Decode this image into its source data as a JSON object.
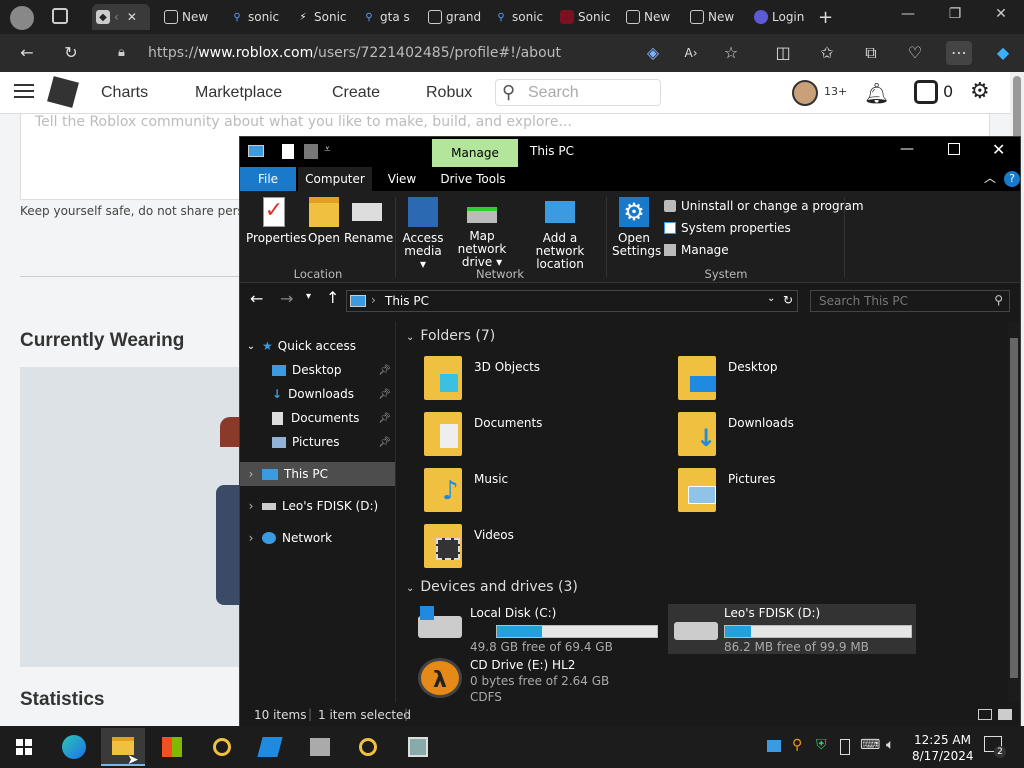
{
  "browser": {
    "tabs": [
      {
        "label": "",
        "icon": "roblox-icon"
      },
      {
        "label": "New",
        "icon": "newtab-icon"
      },
      {
        "label": "sonic",
        "icon": "search-icon"
      },
      {
        "label": "Sonic",
        "icon": "sonic-icon"
      },
      {
        "label": "gta s",
        "icon": "search-icon"
      },
      {
        "label": "grand",
        "icon": "page-icon"
      },
      {
        "label": "sonic",
        "icon": "search-icon"
      },
      {
        "label": "Sonic",
        "icon": "sonic-game-icon"
      },
      {
        "label": "New",
        "icon": "newtab-icon"
      },
      {
        "label": "New",
        "icon": "newtab-icon"
      },
      {
        "label": "Login",
        "icon": "login-icon"
      }
    ],
    "url_prefix": "https://",
    "url_domain": "www.roblox.com",
    "url_path": "/users/7221402485/profile#!/about"
  },
  "roblox": {
    "nav": {
      "charts": "Charts",
      "marketplace": "Marketplace",
      "create": "Create",
      "robux": "Robux",
      "search_placeholder": "Search",
      "age": "13+",
      "robux_count": "0"
    },
    "about_placeholder": "Tell the Roblox community about what you like to make, build, and explore...",
    "safety_note": "Keep yourself safe, do not share persona",
    "currently_wearing": "Currently Wearing",
    "statistics": "Statistics"
  },
  "explorer": {
    "title": "This PC",
    "manage_tab": "Manage",
    "tabs": {
      "file": "File",
      "computer": "Computer",
      "view": "View",
      "drive_tools": "Drive Tools"
    },
    "ribbon": {
      "properties": "Properties",
      "open": "Open",
      "rename": "Rename",
      "access_media_1": "Access",
      "access_media_2": "media ▾",
      "map_network_1": "Map network",
      "map_network_2": "drive ▾",
      "add_network_1": "Add a network",
      "add_network_2": "location",
      "open_settings_1": "Open",
      "open_settings_2": "Settings",
      "uninstall": "Uninstall or change a program",
      "system_properties": "System properties",
      "manage": "Manage",
      "group_location": "Location",
      "group_network": "Network",
      "group_system": "System"
    },
    "breadcrumb": "This PC",
    "search_placeholder": "Search This PC",
    "sidebar": {
      "quick_access": "Quick access",
      "desktop": "Desktop",
      "downloads": "Downloads",
      "documents": "Documents",
      "pictures": "Pictures",
      "this_pc": "This PC",
      "fdisk": "Leo's FDISK (D:)",
      "network": "Network"
    },
    "folders_header": "Folders (7)",
    "folders": [
      "3D Objects",
      "Desktop",
      "Documents",
      "Downloads",
      "Music",
      "Pictures",
      "Videos"
    ],
    "devices_header": "Devices and drives (3)",
    "drives": [
      {
        "name": "Local Disk (C:)",
        "free": "49.8 GB free of 69.4 GB",
        "used_fraction": 0.28
      },
      {
        "name": "Leo's FDISK (D:)",
        "free": "86.2 MB free of 99.9 MB",
        "used_fraction": 0.14
      },
      {
        "name": "CD Drive (E:) HL2",
        "free": "0 bytes free of 2.64 GB",
        "fs": "CDFS"
      }
    ],
    "status": {
      "items": "10 items",
      "selected": "1 item selected"
    }
  },
  "taskbar": {
    "time": "12:25 AM",
    "date": "8/17/2024",
    "notifications": "2"
  },
  "colors": {
    "accent": "#0078d7",
    "manage_tab": "#b3e59a",
    "progress": "#26a0da"
  }
}
